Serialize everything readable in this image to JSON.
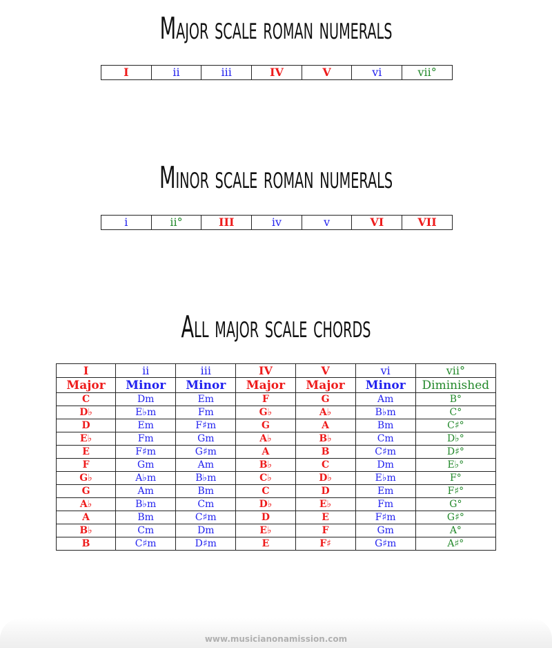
{
  "titles": {
    "major_numerals": "Major scale roman numerals",
    "minor_numerals": "Minor scale roman numerals",
    "all_chords": "All major scale chords"
  },
  "colors": {
    "major": "#ee1c1c",
    "minor": "#2222ee",
    "diminished": "#22882a"
  },
  "major_numerals": [
    {
      "label": "I",
      "quality": "major"
    },
    {
      "label": "ii",
      "quality": "minor"
    },
    {
      "label": "iii",
      "quality": "minor"
    },
    {
      "label": "IV",
      "quality": "major"
    },
    {
      "label": "V",
      "quality": "major"
    },
    {
      "label": "vi",
      "quality": "minor"
    },
    {
      "label": "vii°",
      "quality": "diminished"
    }
  ],
  "minor_numerals": [
    {
      "label": "i",
      "quality": "minor"
    },
    {
      "label": "ii°",
      "quality": "diminished"
    },
    {
      "label": "III",
      "quality": "major"
    },
    {
      "label": "iv",
      "quality": "minor"
    },
    {
      "label": "v",
      "quality": "minor"
    },
    {
      "label": "VI",
      "quality": "major"
    },
    {
      "label": "VII",
      "quality": "major"
    }
  ],
  "chord_table": {
    "numerals": [
      "I",
      "ii",
      "iii",
      "IV",
      "V",
      "vi",
      "vii°"
    ],
    "qualities": [
      "Major",
      "Minor",
      "Minor",
      "Major",
      "Major",
      "Minor",
      "Diminished"
    ],
    "rows": [
      [
        "C",
        "Dm",
        "Em",
        "F",
        "G",
        "Am",
        "B°"
      ],
      [
        "D♭",
        "E♭m",
        "Fm",
        "G♭",
        "A♭",
        "B♭m",
        "C°"
      ],
      [
        "D",
        "Em",
        "F♯m",
        "G",
        "A",
        "Bm",
        "C♯°"
      ],
      [
        "E♭",
        "Fm",
        "Gm",
        "A♭",
        "B♭",
        "Cm",
        "D♭°"
      ],
      [
        "E",
        "F♯m",
        "G♯m",
        "A",
        "B",
        "C♯m",
        "D♯°"
      ],
      [
        "F",
        "Gm",
        "Am",
        "B♭",
        "C",
        "Dm",
        "E♭°"
      ],
      [
        "G♭",
        "A♭m",
        "B♭m",
        "C♭",
        "D♭",
        "E♭m",
        "F°"
      ],
      [
        "G",
        "Am",
        "Bm",
        "C",
        "D",
        "Em",
        "F♯°"
      ],
      [
        "A♭",
        "B♭m",
        "Cm",
        "D♭",
        "E♭",
        "Fm",
        "G°"
      ],
      [
        "A",
        "Bm",
        "C♯m",
        "D",
        "E",
        "F♯m",
        "G♯°"
      ],
      [
        "B♭",
        "Cm",
        "Dm",
        "E♭",
        "F",
        "Gm",
        "A°"
      ],
      [
        "B",
        "C♯m",
        "D♯m",
        "E",
        "F♯",
        "G♯m",
        "A♯°"
      ]
    ]
  },
  "footer": {
    "url": "www.musicianonamission.com"
  }
}
